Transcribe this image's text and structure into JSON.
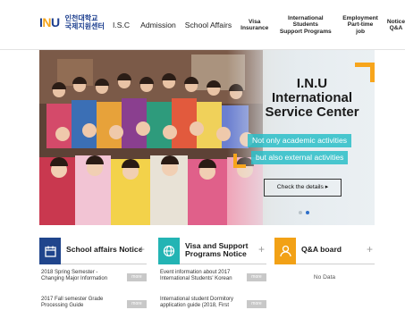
{
  "logo": {
    "mark_prefix": "I",
    "mark_u": "N",
    "mark_suffix": "U",
    "line1": "인천대학교",
    "line2": "국제지원센터"
  },
  "nav": {
    "items": [
      {
        "label": "I.S.C"
      },
      {
        "label": "Admission"
      },
      {
        "label": "School Affairs"
      },
      {
        "label": "Visa\nInsurance"
      },
      {
        "label": "International Students\nSupport Programs"
      },
      {
        "label": "Employment\nPart-time job"
      },
      {
        "label": "Notice\nQ&A"
      }
    ]
  },
  "hero": {
    "title_line1": "I.N.U",
    "title_line2": "International",
    "title_line3": "Service Center",
    "tag1": "Not only academic activities",
    "tag2": "but also external activities",
    "details_button": "Check the details ▸"
  },
  "boards": {
    "school_affairs": {
      "title": "School affairs Notice",
      "plus": "+",
      "rows": [
        {
          "text": "2018 Spring Semester - Changing Major Information",
          "badge": "more"
        },
        {
          "text": "2017 Fall semester Grade Processing Guide",
          "badge": "more"
        }
      ]
    },
    "visa": {
      "title_line1": "Visa and Support",
      "title_line2": "Programs Notice",
      "plus": "+",
      "rows": [
        {
          "text": "Event information about 2017 International Students' Korean",
          "badge": "more"
        },
        {
          "text": "International student Dormitory application guide (2018, First",
          "badge": "more"
        }
      ]
    },
    "qa": {
      "title": "Q&A board",
      "plus": "+",
      "empty_text": "No Data"
    }
  },
  "colors": {
    "accent_orange": "#f7a51c",
    "tag_teal": "#2cbec8",
    "board_blue": "#20458c",
    "board_teal": "#23b4b4",
    "board_orange": "#f2a116"
  },
  "icons": {
    "school_affairs": "calendar-icon",
    "visa": "globe-icon",
    "qa": "person-icon"
  }
}
